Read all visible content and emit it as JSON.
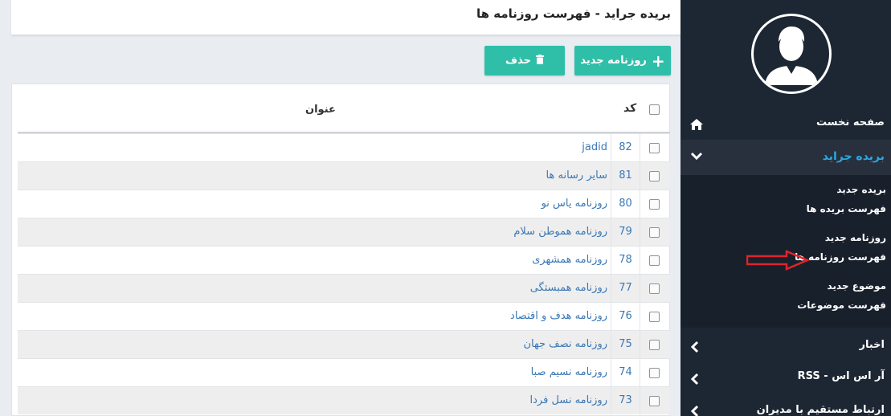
{
  "header": {
    "title": "بریده جراید - فهرست روزنامه ها"
  },
  "toolbar": {
    "new_label": "روزنامه جدید",
    "delete_label": "حذف"
  },
  "table": {
    "columns": {
      "code": "کد",
      "title": "عنوان"
    },
    "rows": [
      {
        "code": "82",
        "title": "jadid"
      },
      {
        "code": "81",
        "title": "سایر رسانه ها"
      },
      {
        "code": "80",
        "title": "روزنامه یاس نو"
      },
      {
        "code": "79",
        "title": "روزنامه هموطن سلام"
      },
      {
        "code": "78",
        "title": "روزنامه همشهری"
      },
      {
        "code": "77",
        "title": "روزنامه همبستگی"
      },
      {
        "code": "76",
        "title": "روزنامه هدف و اقتصاد"
      },
      {
        "code": "75",
        "title": "روزنامه نصف جهان"
      },
      {
        "code": "74",
        "title": "روزنامه نسیم صبا"
      },
      {
        "code": "73",
        "title": "روزنامه نسل فردا"
      }
    ]
  },
  "sidebar": {
    "home": "صفحه نخست",
    "active_section": "بریده جراید",
    "submenu": [
      "بریده جدید",
      "فهرست بریده ها",
      "روزنامه جدید",
      "فهرست روزنامه ها",
      "موضوع جدید",
      "فهرست موضوعات"
    ],
    "news": "اخبار",
    "rss": "آر اس اس - RSS",
    "contact": "ارتباط مستقیم با مدیران"
  },
  "colors": {
    "accent": "#2fbfa9",
    "sidebar_bg": "#1d2633",
    "active_text": "#2aa9e0",
    "link": "#3a78b5",
    "annotation_arrow": "#e0242a"
  }
}
